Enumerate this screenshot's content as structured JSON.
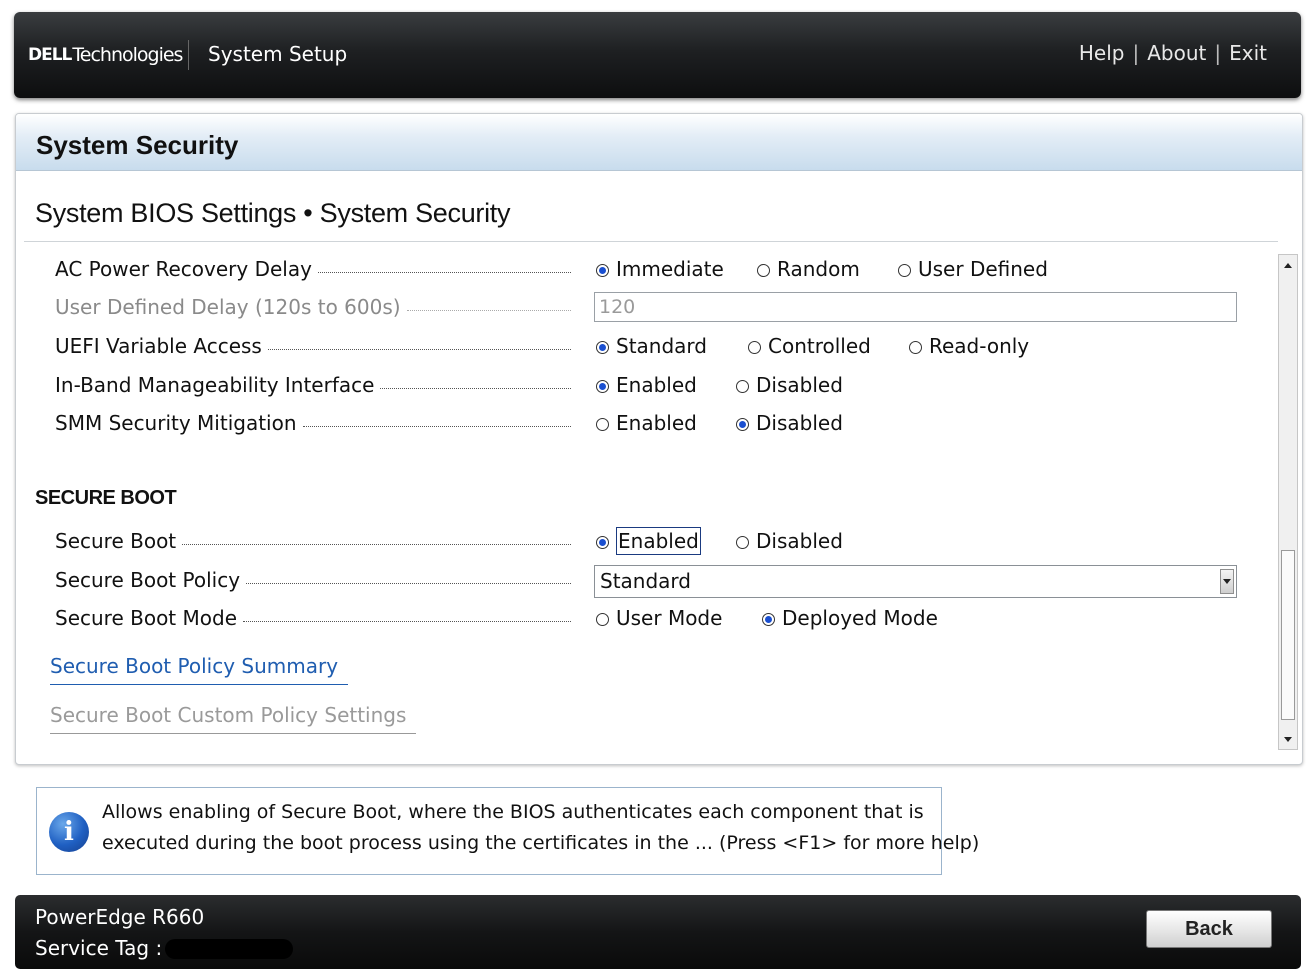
{
  "header": {
    "brand_dell": "DELL",
    "brand_tech": "Technologies",
    "app_title": "System Setup",
    "links": [
      "Help",
      "About",
      "Exit"
    ]
  },
  "panel": {
    "title": "System Security",
    "breadcrumb": "System BIOS Settings • System Security"
  },
  "settings": {
    "ac_power_recovery_delay": {
      "label": "AC Power Recovery Delay",
      "options": [
        "Immediate",
        "Random",
        "User Defined"
      ],
      "selected": "Immediate"
    },
    "user_defined_delay": {
      "label": "User Defined Delay (120s to 600s)",
      "value": "120",
      "disabled": true
    },
    "uefi_variable_access": {
      "label": "UEFI Variable Access",
      "options": [
        "Standard",
        "Controlled",
        "Read-only"
      ],
      "selected": "Standard"
    },
    "in_band_manageability": {
      "label": "In-Band Manageability Interface",
      "options": [
        "Enabled",
        "Disabled"
      ],
      "selected": "Enabled"
    },
    "smm_security_mitigation": {
      "label": "SMM Security Mitigation",
      "options": [
        "Enabled",
        "Disabled"
      ],
      "selected": "Disabled"
    }
  },
  "secure_boot_section": {
    "heading": "SECURE BOOT",
    "secure_boot": {
      "label": "Secure Boot",
      "options": [
        "Enabled",
        "Disabled"
      ],
      "selected": "Enabled"
    },
    "secure_boot_policy": {
      "label": "Secure Boot Policy",
      "value": "Standard"
    },
    "secure_boot_mode": {
      "label": "Secure Boot Mode",
      "options": [
        "User Mode",
        "Deployed Mode"
      ],
      "selected": "Deployed Mode"
    },
    "links": [
      "Secure Boot Policy Summary",
      "Secure Boot Custom Policy Settings"
    ]
  },
  "help": {
    "line1": "Allows enabling of Secure Boot, where the BIOS authenticates each component that is",
    "line2": "executed during the boot process using the certificates in the ... (Press <F1> for more help)"
  },
  "footer": {
    "model": "PowerEdge R660",
    "service_tag_label": "Service Tag :",
    "back_label": "Back"
  },
  "icons": {
    "info": "info-icon",
    "scroll_up": "scroll-up-arrow-icon",
    "scroll_down": "scroll-down-arrow-icon",
    "dropdown": "chevron-down-icon"
  },
  "colors": {
    "accent_blue": "#1a4fd0",
    "link_blue": "#1f5db0",
    "header_dark": "#1e2022",
    "panel_header_blue": "#c8dced"
  }
}
